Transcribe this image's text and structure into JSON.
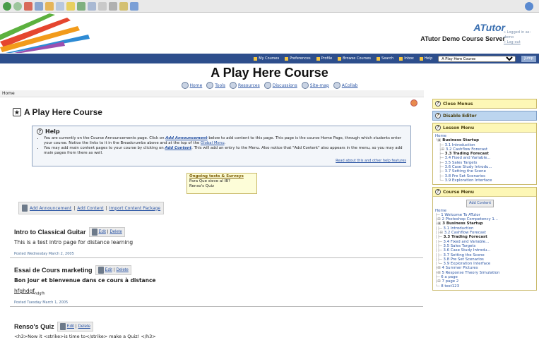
{
  "site": {
    "brand": "ATutor",
    "server": "ATutor Demo Course Server",
    "user_info": [
      "» Logged in as: demo",
      "» Log-out"
    ]
  },
  "nav": {
    "items": [
      "My Courses",
      "Preferences",
      "Profile",
      "Browse Courses",
      "Search",
      "Inbox",
      "Help"
    ],
    "jump_value": "A Play Here Course",
    "go_label": "Jump"
  },
  "course": {
    "title": "A Play Here Course",
    "subnav": [
      "Home",
      "Tools",
      "Resources",
      "Discussions",
      "Site-map",
      "ACollab"
    ]
  },
  "breadcrumb": "Home",
  "page_heading": "A Play Here Course",
  "help": {
    "title": "Help",
    "line1_pre": "You are currently on the Course Announcements page. Click on ",
    "line1_link": "Add Announcement",
    "line1_post": " below to add content to this page. This page is the course Home Page, through which students enter your course. Notice the links to it in the Breadcrumbs above and at the top of the ",
    "line1_link2": "Global Menu",
    "line2_pre": "You may add main content pages to your course by clicking on ",
    "line2_link": "Add Content",
    "line2_post": ". This will add an entry to the Menu. Also notice that \"Add Content\" also appears in the menu, so you may add main pages from there as well.",
    "read_more": "Read about this and other help features"
  },
  "poll": {
    "title": "Ongoing tests & Surveys",
    "items": [
      "Para Que sieve al IB?",
      "Renso's Quiz"
    ]
  },
  "actions": {
    "add_announcement": "Add Announcement",
    "add_content": "Add Content",
    "import": "Import Content Package",
    "sep": "|"
  },
  "posts": [
    {
      "title": "Intro to Classical Guitar",
      "edit": "Edit",
      "delete": "Delete",
      "body": "This is a test intro page for distance learning",
      "date": "Posted Wednesday March 2, 2005"
    },
    {
      "title": "Essai de Cours marketing",
      "edit": "Edit",
      "delete": "Delete",
      "body": "Bon jour et bienvenue dans ce cours à distance",
      "body2": "hfghdgf",
      "body2_sub": "hdgfh",
      "date": "Posted Tuesday March 1, 2005"
    },
    {
      "title": "Renso's Quiz",
      "edit": "Edit",
      "delete": "Delete",
      "body": "<h3>Now it <strike>is time to</strike> make a Quiz! </h3>"
    }
  ],
  "sidebar": {
    "close_menus": "Close Menus",
    "disable_editor": "Disable Editor",
    "lesson_menu": {
      "title": "Lesson Menu",
      "home": "Home",
      "items": [
        "Business Startup",
        "3.1 Introduction",
        "3.2 Cashflow Forecast",
        "3.3 Trading Forecast",
        "3.4 Fixed and Variable...",
        "3.5 Sales Targets",
        "3.6 Case Study Introdu...",
        "3.7 Setting the Scene",
        "3.8 Pre Set Scenarios",
        "3.9 Exploration Interface"
      ]
    },
    "course_menu": {
      "title": "Course Menu",
      "add_content": "Add Content",
      "home": "Home",
      "items": [
        "1 Welcome To ATutor",
        "2 Photoshop Competency 1...",
        "3 Business Startup",
        "3.1 Introduction",
        "3.2 Cashflow Forecast",
        "3.3 Trading Forecast",
        "3.4 Fixed and Variable...",
        "3.5 Sales Targets",
        "3.6 Case Study Introdu...",
        "3.7 Setting the Scene",
        "3.8 Pre Set Scenarios",
        "3.9 Exploration Interface",
        "4 Summer Pictures",
        "5 Response Theory Simulation",
        "6 a page",
        "7 page 2",
        "8 test123"
      ]
    }
  }
}
